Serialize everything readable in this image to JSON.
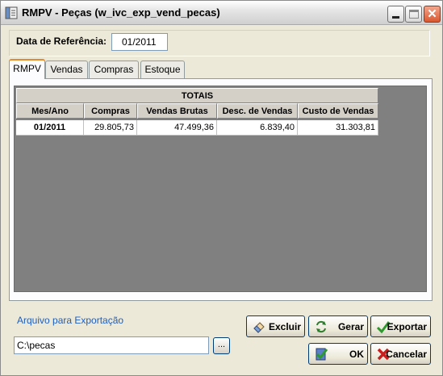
{
  "window": {
    "title": "RMPV - Peças (w_ivc_exp_vend_pecas)",
    "close_glyph": "✕"
  },
  "reference": {
    "label": "Data de Referência:",
    "value": "01/2011"
  },
  "tabs": [
    {
      "label": "RMPV",
      "active": true
    },
    {
      "label": "Vendas",
      "active": false
    },
    {
      "label": "Compras",
      "active": false
    },
    {
      "label": "Estoque",
      "active": false
    }
  ],
  "grid": {
    "group_header": "TOTAIS",
    "columns": [
      "Mes/Ano",
      "Compras",
      "Vendas Brutas",
      "Desc. de Vendas",
      "Custo de Vendas"
    ],
    "rows": [
      [
        "01/2011",
        "29.805,73",
        "47.499,36",
        "6.839,40",
        "31.303,81"
      ]
    ]
  },
  "export": {
    "label": "Arquivo para Exportação",
    "path": "C:\\pecas",
    "browse_label": "..."
  },
  "buttons": {
    "excluir": "Excluir",
    "gerar": "Gerar",
    "exportar": "Exportar",
    "ok": "OK",
    "cancelar": "Cancelar"
  },
  "icons": {
    "app": "app-window-icon",
    "excluir": "eraser-icon",
    "gerar": "refresh-icon",
    "exportar": "checkmark-icon",
    "ok": "document-check-icon",
    "cancelar": "x-icon"
  },
  "colors": {
    "tab_active_accent": "#e68b2c",
    "export_label": "#1e5fc0",
    "close_button": "#d9582f",
    "check_green": "#2e9a2e",
    "cancel_red": "#c81e1e"
  }
}
